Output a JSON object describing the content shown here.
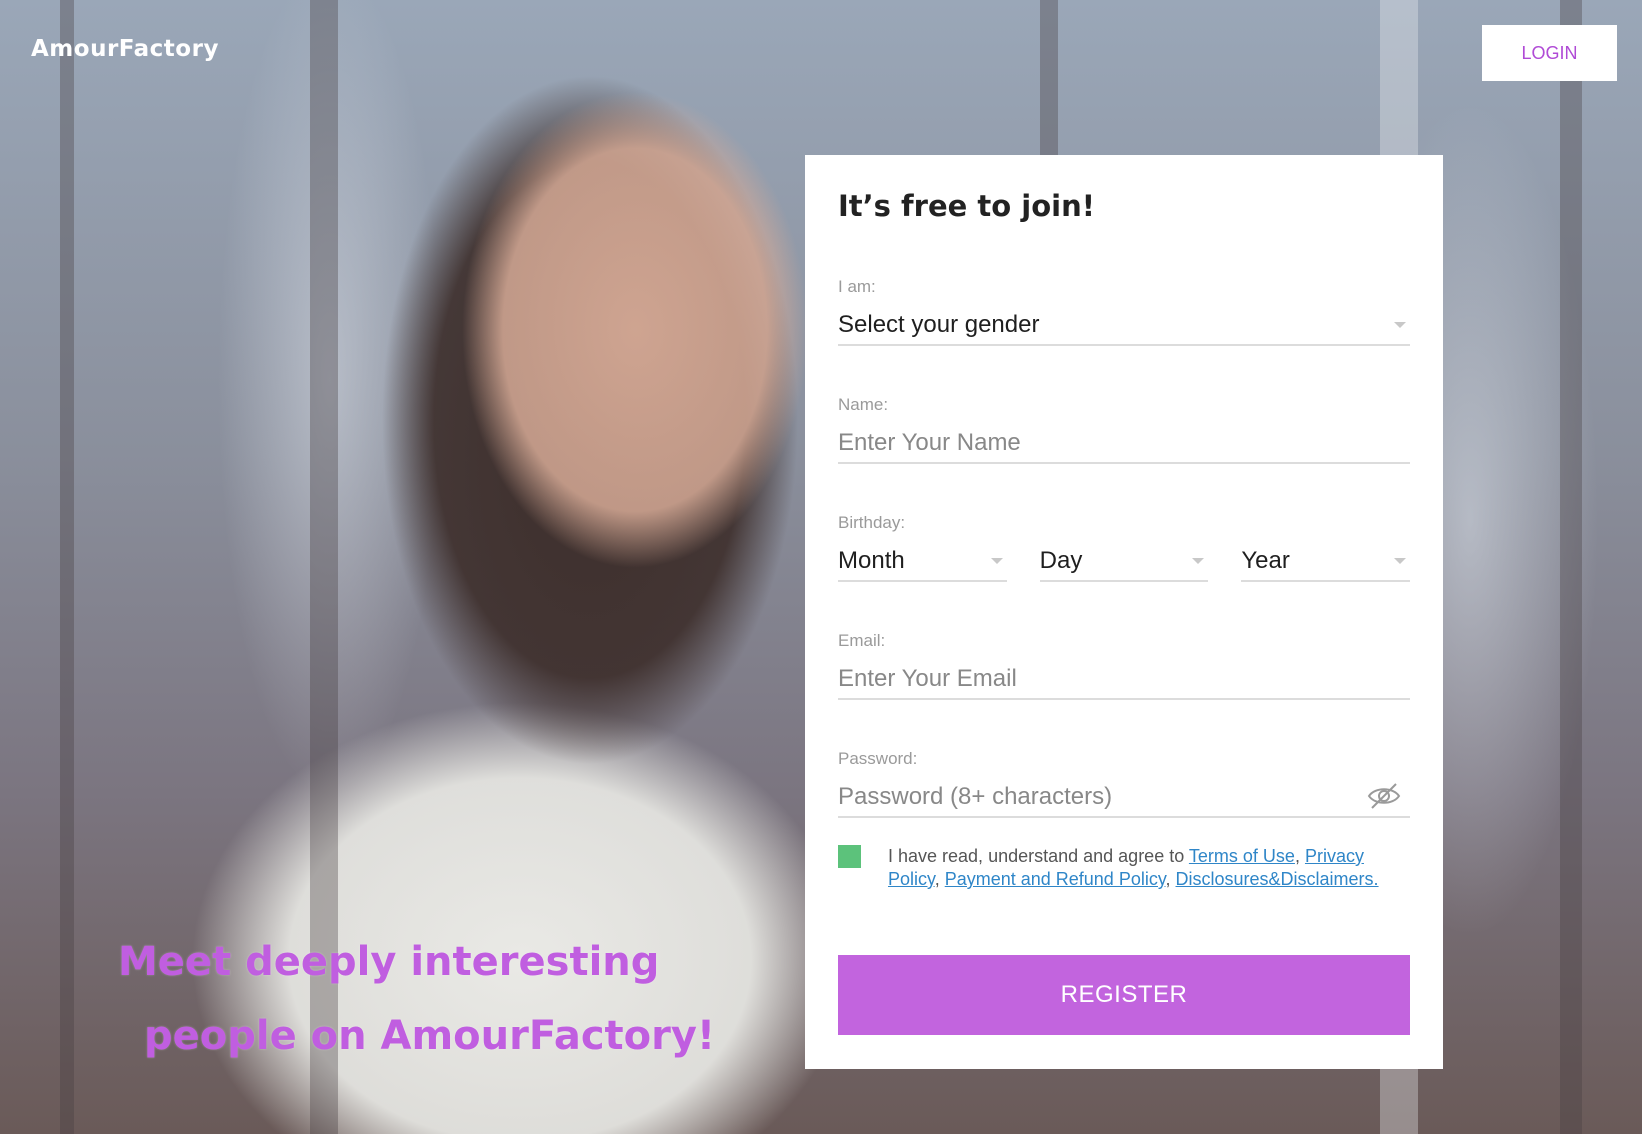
{
  "header": {
    "logo": "AmourFactory",
    "login_label": "LOGIN"
  },
  "hero": {
    "tagline_line1": "Meet deeply interesting",
    "tagline_line2": "people on AmourFactory!"
  },
  "form": {
    "title": "It’s free to join!",
    "gender": {
      "label": "I am:",
      "value": "Select your gender"
    },
    "name": {
      "label": "Name:",
      "placeholder": "Enter Your Name"
    },
    "birthday": {
      "label": "Birthday:",
      "month": "Month",
      "day": "Day",
      "year": "Year"
    },
    "email": {
      "label": "Email:",
      "placeholder": "Enter Your Email"
    },
    "password": {
      "label": "Password:",
      "placeholder": "Password (8+ characters)"
    },
    "agree": {
      "prefix": "I have read, understand and agree to",
      "terms": "Terms of Use",
      "privacy": "Privacy Policy",
      "payment": "Payment and Refund Policy",
      "disclosures": "Disclosures&Disclaimers."
    },
    "register_label": "REGISTER"
  },
  "colors": {
    "accent": "#c264de",
    "link": "#2f86c8",
    "checkbox": "#5cc27b",
    "tagline": "#c05ee0"
  },
  "icons": [
    "chevron-down-icon",
    "eye-off-icon"
  ]
}
